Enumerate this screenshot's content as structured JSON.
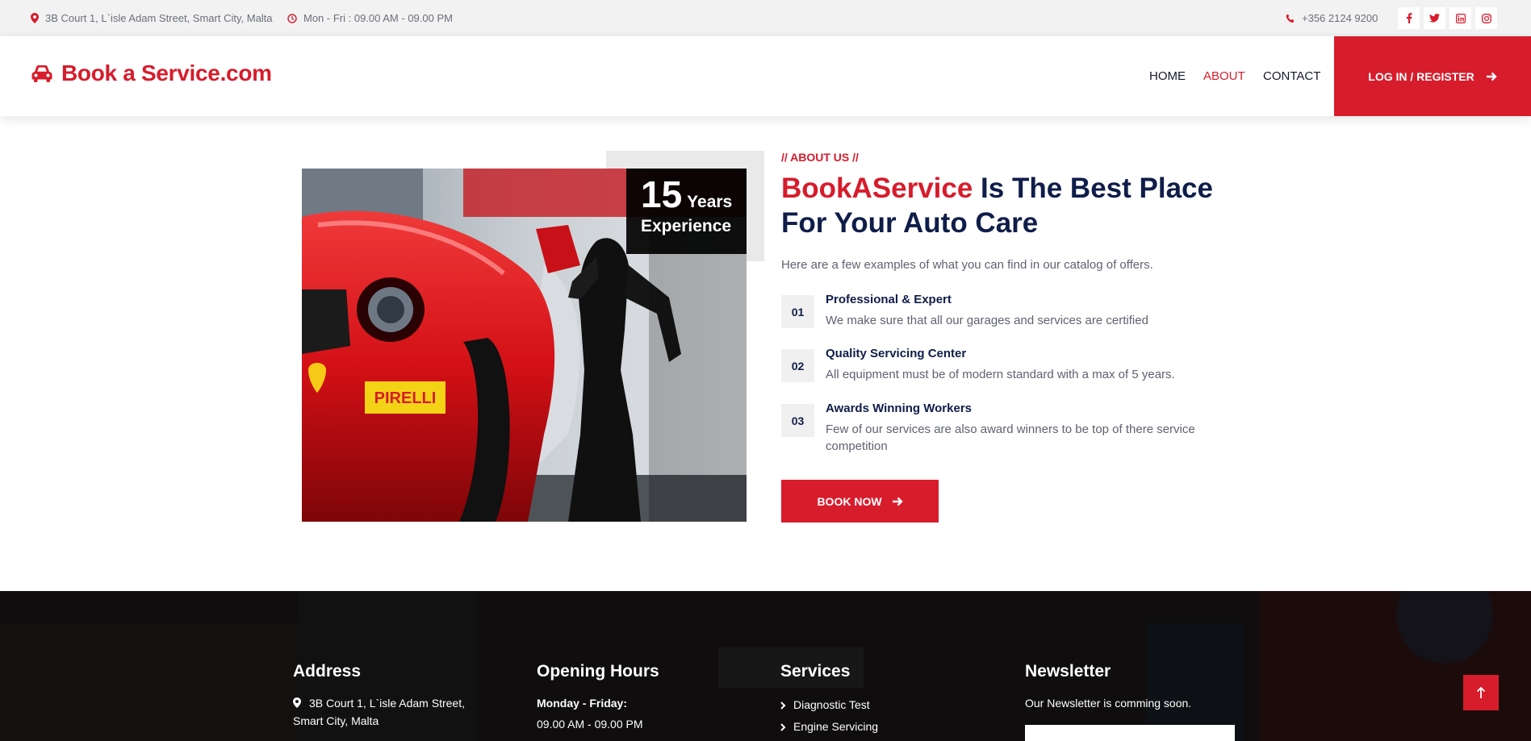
{
  "topbar": {
    "address": "3B Court 1, L`isle Adam Street, Smart City, Malta",
    "hours": "Mon - Fri : 09.00 AM - 09.00 PM",
    "phone": "+356 2124 9200",
    "social_icons": [
      "facebook-icon",
      "twitter-icon",
      "linkedin-icon",
      "instagram-icon"
    ]
  },
  "header": {
    "logo": "Book a Service.com",
    "nav": [
      {
        "label": "HOME"
      },
      {
        "label": "ABOUT",
        "active": true
      },
      {
        "label": "CONTACT"
      }
    ],
    "login_label": "LOG IN / REGISTER"
  },
  "about": {
    "experience_number": "15",
    "experience_years": "Years",
    "experience_label": "Experience",
    "eyebrow": "// ABOUT US //",
    "title_brand": "BookAService",
    "title_rest": " Is The Best Place For Your Auto Care",
    "lead": "Here are a few examples of what you can find in our catalog of offers.",
    "features": [
      {
        "num": "01",
        "title": "Professional & Expert",
        "desc": "We make sure that all our garages and services are certified"
      },
      {
        "num": "02",
        "title": "Quality Servicing Center",
        "desc": "All equipment must be of modern standard with a max of 5 years."
      },
      {
        "num": "03",
        "title": "Awards Winning Workers",
        "desc": "Few of our services are also award winners to be top of there service competition"
      }
    ],
    "book_label": "BOOK NOW",
    "photo_brands": [
      "PIRELLI"
    ]
  },
  "footer": {
    "address_title": "Address",
    "address_text": "3B Court 1, L`isle Adam Street, Smart City, Malta",
    "hours_title": "Opening Hours",
    "hours_days": "Monday - Friday:",
    "hours_time": "09.00 AM - 09.00 PM",
    "services_title": "Services",
    "services": [
      "Diagnostic Test",
      "Engine Servicing"
    ],
    "newsletter_title": "Newsletter",
    "newsletter_text": "Our Newsletter is comming soon."
  },
  "colors": {
    "brand_red": "#d71c2c",
    "navy": "#0f1d49"
  }
}
